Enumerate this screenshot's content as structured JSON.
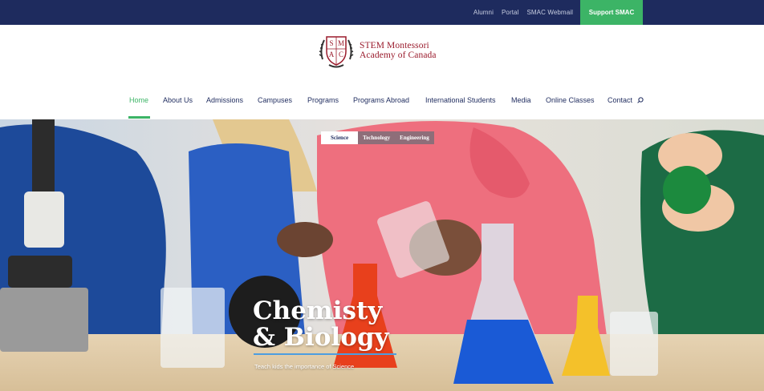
{
  "topbar": {
    "links": [
      "Alumni",
      "Portal",
      "SMAC Webmail"
    ],
    "support_label": "Support SMAC",
    "bg_color": "#1e2b5e",
    "accent_color": "#3cb466"
  },
  "logo": {
    "line1": "STEM Montessori",
    "line2": "Academy of Canada",
    "crest_letters": [
      "S",
      "M",
      "A",
      "C"
    ]
  },
  "nav": {
    "items": [
      {
        "label": "Home",
        "active": true
      },
      {
        "label": "About Us"
      },
      {
        "label": "Admissions"
      },
      {
        "label": "Campuses"
      },
      {
        "label": "Programs"
      },
      {
        "label": "Programs Abroad"
      },
      {
        "label": "International Students"
      },
      {
        "label": "Media"
      },
      {
        "label": "Online Classes"
      },
      {
        "label": "Contact"
      }
    ],
    "search_icon": "search-icon"
  },
  "hero": {
    "tabs": [
      {
        "label": "Science",
        "active": true
      },
      {
        "label": "Technology"
      },
      {
        "label": "Engineering"
      }
    ],
    "title_line1": "Chemisty",
    "title_line2": "& Biology",
    "subtitle": "Teach kids the importance of Science"
  }
}
